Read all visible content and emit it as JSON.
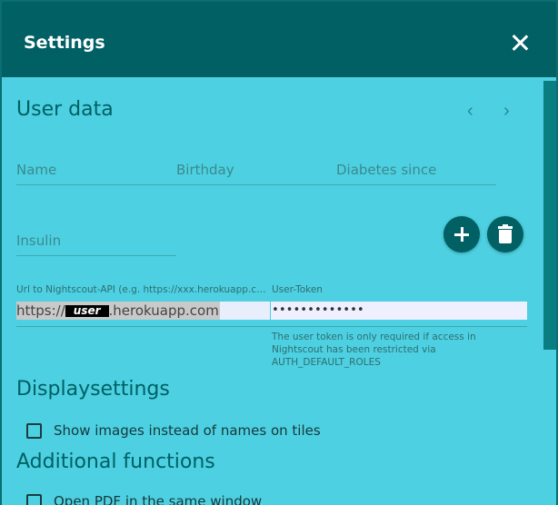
{
  "dialog": {
    "title": "Settings",
    "close_icon": "close-icon"
  },
  "user_data": {
    "heading": "User data",
    "prev_icon": "chevron-left-icon",
    "next_icon": "chevron-right-icon",
    "name_label": "Name",
    "birthday_label": "Birthday",
    "diabetes_since_label": "Diabetes since",
    "insulin_label": "Insulin",
    "add_icon": "plus-icon",
    "delete_icon": "trash-icon",
    "url_label": "Url to Nightscout-API (e.g. https://xxx.herokuapp.com)",
    "url_value_prefix": "https://",
    "url_value_redacted": "user",
    "url_value_suffix": ".herokuapp.com",
    "token_label": "User-Token",
    "token_value": "•••••••••••••",
    "token_hint": "The user token is only required if access in Nightscout has been restricted via AUTH_DEFAULT_ROLES"
  },
  "display_settings": {
    "heading": "Displaysettings",
    "show_images_label": "Show images instead of names on tiles",
    "show_images_checked": false
  },
  "additional_functions": {
    "heading": "Additional functions",
    "open_pdf_label": "Open PDF in the same window",
    "open_pdf_checked": false
  },
  "colors": {
    "header_bg": "#006064",
    "content_bg": "#4dd0e1",
    "accent": "#006064"
  }
}
